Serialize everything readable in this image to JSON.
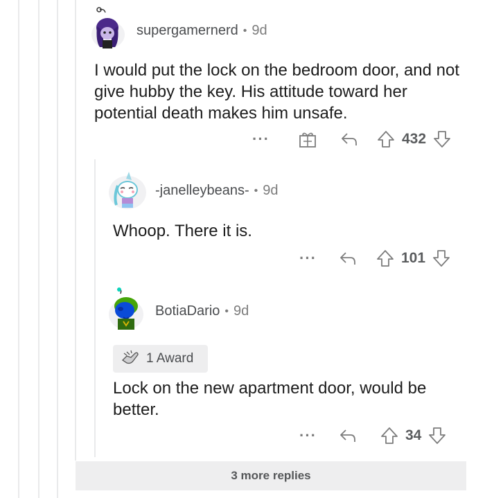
{
  "comments": [
    {
      "username": "supergamernerd",
      "age": "9d",
      "body": "I would put the lock on the bedroom door, and not give hubby the key. His attitude toward her potential death makes him unsafe.",
      "score": "432",
      "avatar_icon": "purple-hair-snoo-avatar",
      "has_gift_icon": true
    },
    {
      "username": "-janelleybeans-",
      "age": "9d",
      "body": "Whoop. There it is.",
      "score": "101",
      "avatar_icon": "unicorn-snoo-avatar"
    },
    {
      "username": "BotiaDario",
      "age": "9d",
      "award": "1 Award",
      "body": "Lock on the new apartment door, would be better.",
      "score": "34",
      "avatar_icon": "blue-green-snoo-avatar"
    }
  ],
  "more_replies": "3 more replies",
  "icons": {
    "more": "ellipsis-icon",
    "reply": "reply-arrow-icon",
    "upvote": "upvote-arrow-icon",
    "downvote": "downvote-arrow-icon",
    "gift": "gift-award-icon",
    "award": "hand-award-icon"
  },
  "colors": {
    "text": "#1c1c1c",
    "meta": "#7c7c7c",
    "username": "#4a4c4f",
    "thread_line": "#e9eaeb",
    "chip_bg": "#eeeeef"
  }
}
